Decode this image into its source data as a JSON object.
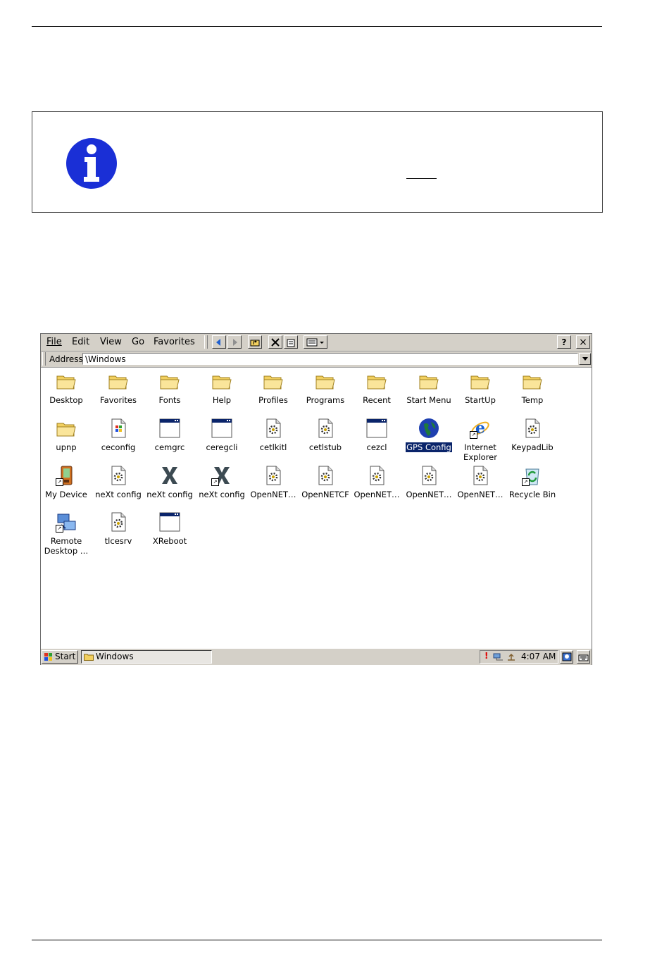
{
  "colors": {
    "info_blue": "#1a2fd6",
    "selection": "#0a246a",
    "chrome": "#d4d0c8",
    "folder": "#f2d060"
  },
  "window": {
    "menu": [
      {
        "label": "File",
        "icon": "file-menu"
      },
      {
        "label": "Edit",
        "icon": "edit-menu"
      },
      {
        "label": "View",
        "icon": "view-menu"
      },
      {
        "label": "Go",
        "icon": "go-menu"
      },
      {
        "label": "Favorites",
        "icon": "favorites-menu"
      }
    ],
    "toolbar_icons": [
      "back-arrow-icon",
      "forward-arrow-icon",
      "up-folder-icon",
      "delete-icon",
      "properties-icon",
      "views-icon"
    ],
    "help_label": "?",
    "close_label": "×",
    "address_label": "Address",
    "address_value": "\\Windows",
    "files": [
      {
        "label": "Desktop",
        "icon": "folder"
      },
      {
        "label": "Favorites",
        "icon": "folder"
      },
      {
        "label": "Fonts",
        "icon": "folder"
      },
      {
        "label": "Help",
        "icon": "folder"
      },
      {
        "label": "Profiles",
        "icon": "folder"
      },
      {
        "label": "Programs",
        "icon": "folder"
      },
      {
        "label": "Recent",
        "icon": "folder"
      },
      {
        "label": "Start Menu",
        "icon": "folder"
      },
      {
        "label": "StartUp",
        "icon": "folder"
      },
      {
        "label": "Temp",
        "icon": "folder"
      },
      {
        "label": "upnp",
        "icon": "folder"
      },
      {
        "label": "ceconfig",
        "icon": "config-file"
      },
      {
        "label": "cemgrc",
        "icon": "app-window"
      },
      {
        "label": "ceregcli",
        "icon": "app-window"
      },
      {
        "label": "cetlkitl",
        "icon": "gear-file"
      },
      {
        "label": "cetlstub",
        "icon": "gear-file"
      },
      {
        "label": "cezcl",
        "icon": "app-window"
      },
      {
        "label": "GPS Config",
        "icon": "globe",
        "selected": true
      },
      {
        "label": "Internet Explorer",
        "icon": "ie-shortcut"
      },
      {
        "label": "KeypadLib",
        "icon": "gear-file"
      },
      {
        "label": "My Device",
        "icon": "device-shortcut"
      },
      {
        "label": "neXt config",
        "icon": "gear-file"
      },
      {
        "label": "neXt config",
        "icon": "next-x"
      },
      {
        "label": "neXt config",
        "icon": "next-x-shortcut"
      },
      {
        "label": "OpenNET…",
        "icon": "gear-file"
      },
      {
        "label": "OpenNETCF",
        "icon": "gear-file"
      },
      {
        "label": "OpenNET…",
        "icon": "gear-file"
      },
      {
        "label": "OpenNET…",
        "icon": "gear-file"
      },
      {
        "label": "OpenNET…",
        "icon": "gear-file"
      },
      {
        "label": "Recycle Bin",
        "icon": "recycle-shortcut"
      },
      {
        "label": "Remote Desktop …",
        "icon": "remote-desktop-shortcut"
      },
      {
        "label": "tlcesrv",
        "icon": "gear-file"
      },
      {
        "label": "XReboot",
        "icon": "app-window"
      }
    ],
    "taskbar": {
      "start_label": "Start",
      "task_label": "Windows",
      "clock": "4:07 AM",
      "tray_icons": [
        "alert-icon",
        "network-icon",
        "usb-icon"
      ],
      "desktop_btn_icon": "desktop-icon",
      "keyboard_btn_icon": "keyboard-icon"
    }
  }
}
